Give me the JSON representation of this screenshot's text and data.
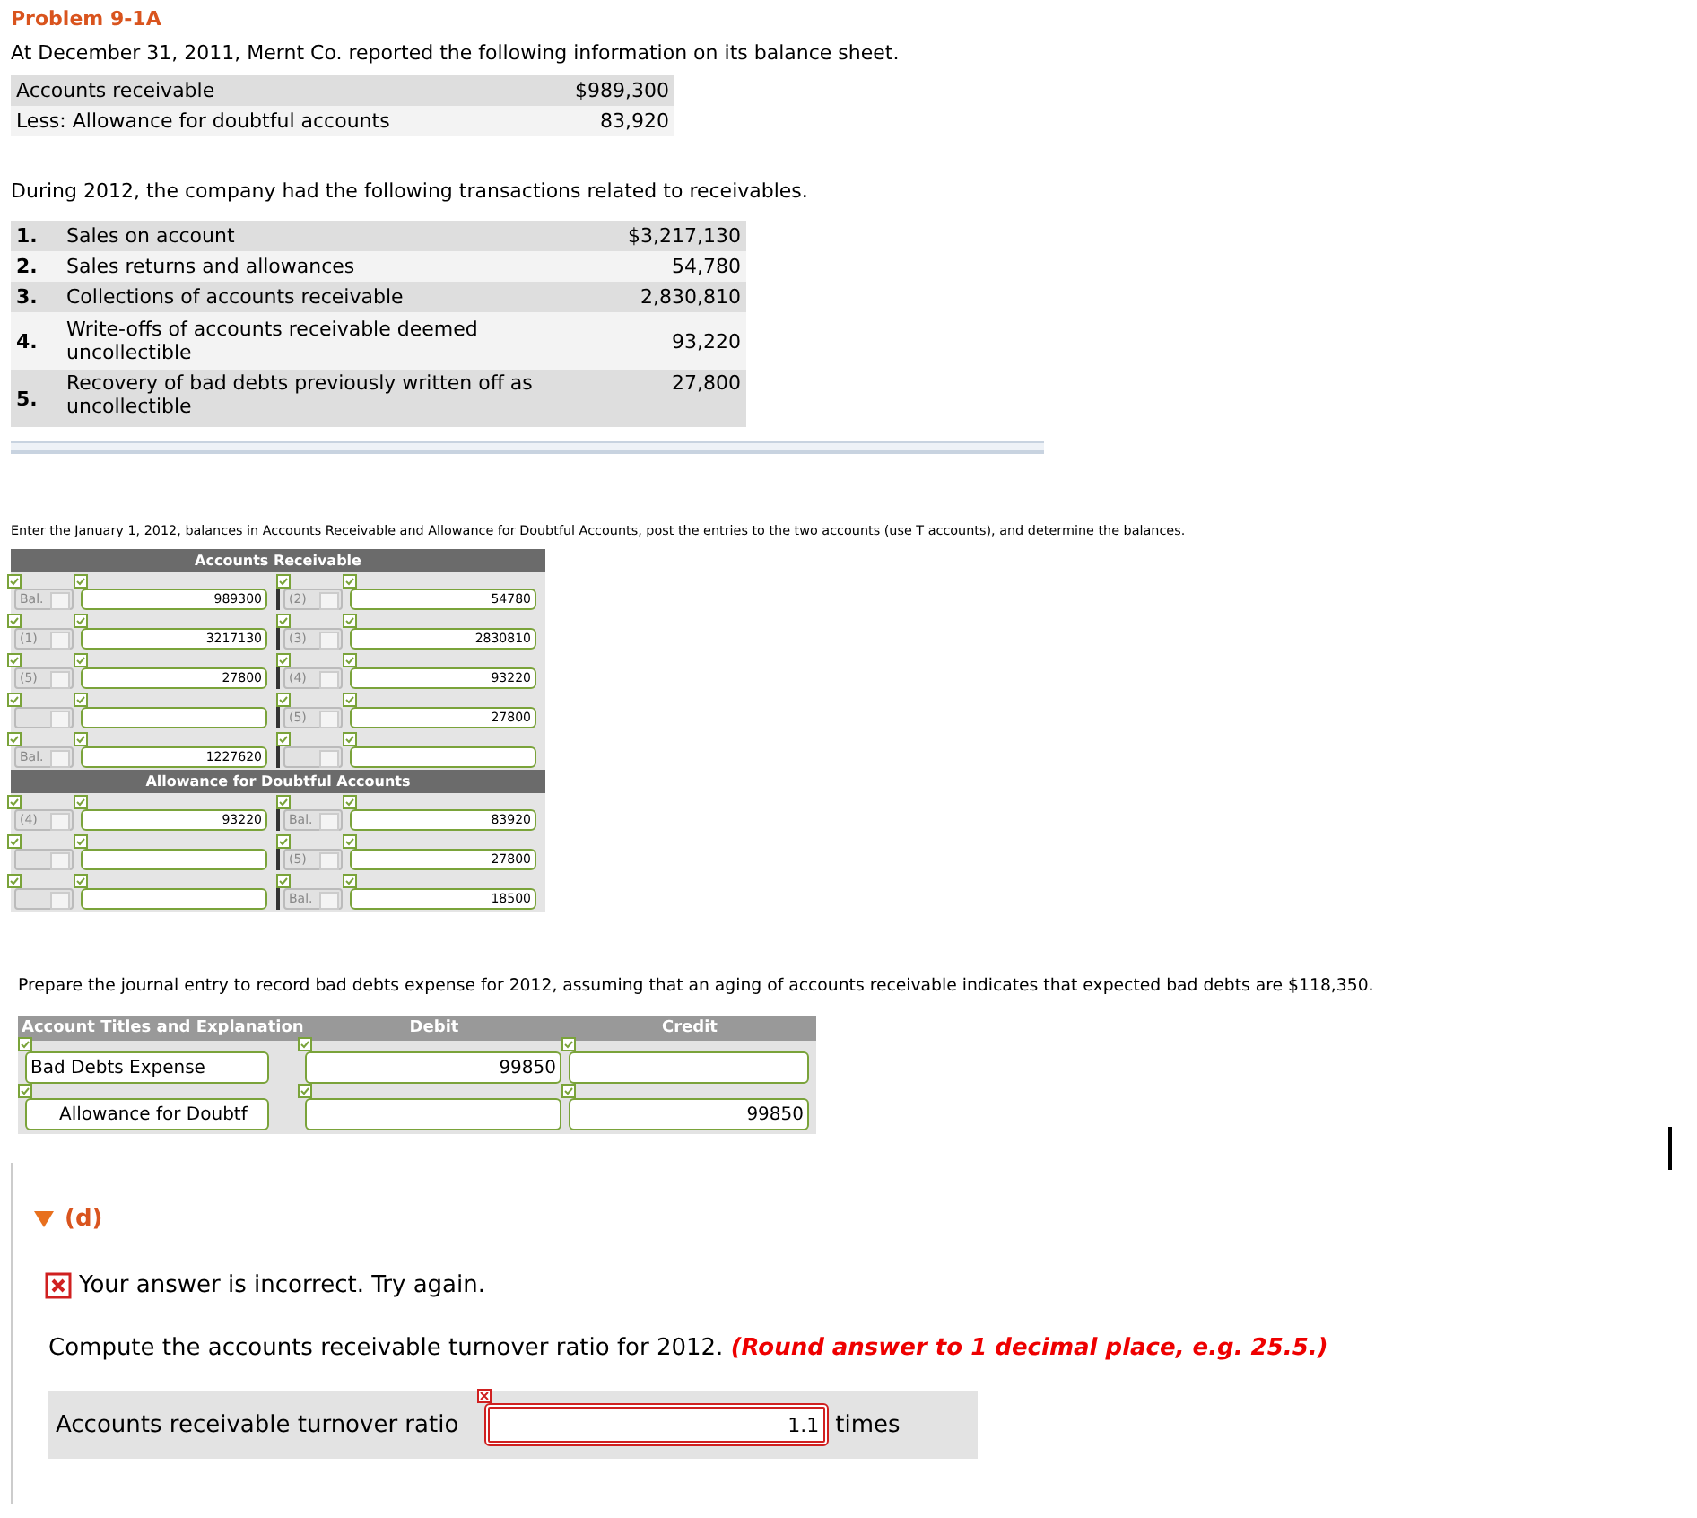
{
  "title": "Problem 9-1A",
  "intro": "At December 31, 2011, Mernt Co. reported the following information on its balance sheet.",
  "balance_sheet": [
    {
      "label": "Accounts receivable",
      "amount": "$989,300"
    },
    {
      "label": "Less: Allowance for doubtful accounts",
      "amount": "83,920"
    }
  ],
  "transactions_intro": "During 2012, the company had the following transactions related to receivables.",
  "transactions": [
    {
      "number": "1.",
      "description": "Sales on account",
      "amount": "$3,217,130"
    },
    {
      "number": "2.",
      "description": "Sales returns and allowances",
      "amount": "54,780"
    },
    {
      "number": "3.",
      "description": "Collections of accounts receivable",
      "amount": "2,830,810"
    },
    {
      "number": "4.",
      "description": "Write-offs of accounts receivable deemed uncollectible",
      "amount": "93,220"
    },
    {
      "number": "5.",
      "description": "Recovery of bad debts previously written off as uncollectible",
      "amount": "27,800"
    }
  ],
  "t_accounts_instruction": "Enter the January 1, 2012, balances in Accounts Receivable and Allowance for Doubtful Accounts, post the entries to the two accounts (use T accounts), and determine the balances.",
  "t_accounts": [
    {
      "title": "Accounts Receivable",
      "rows": [
        {
          "left": {
            "label": "Bal.",
            "value": "989300",
            "correct": true
          },
          "right": {
            "label": "(2)",
            "value": "54780",
            "correct": true
          }
        },
        {
          "left": {
            "label": "(1)",
            "value": "3217130",
            "correct": true
          },
          "right": {
            "label": "(3)",
            "value": "2830810",
            "correct": true
          }
        },
        {
          "left": {
            "label": "(5)",
            "value": "27800",
            "correct": true
          },
          "right": {
            "label": "(4)",
            "value": "93220",
            "correct": true
          }
        },
        {
          "left": {
            "correct": true
          },
          "right": {
            "label": "(5)",
            "value": "27800",
            "correct": true
          }
        },
        {
          "left": {
            "label": "Bal.",
            "value": "1227620",
            "correct": true
          },
          "right": {
            "correct": true
          }
        }
      ]
    },
    {
      "title": "Allowance for Doubtful Accounts",
      "rows": [
        {
          "left": {
            "label": "(4)",
            "value": "93220",
            "correct": true
          },
          "right": {
            "label": "Bal.",
            "value": "83920",
            "correct": true
          }
        },
        {
          "left": {
            "correct": true
          },
          "right": {
            "label": "(5)",
            "value": "27800",
            "correct": true
          }
        },
        {
          "left": {
            "correct": true
          },
          "right": {
            "label": "Bal.",
            "value": "18500",
            "correct": true
          }
        }
      ]
    }
  ],
  "journal_instruction": "Prepare the journal entry to record bad debts expense for 2012, assuming that an aging of accounts receivable indicates that expected bad debts are $118,350.",
  "journal": {
    "columns": [
      "Account Titles and Explanation",
      "Debit",
      "Credit"
    ],
    "rows": [
      {
        "account": "Bad Debts Expense",
        "indented": false,
        "debit": "99850",
        "correct": true
      },
      {
        "account": "Allowance for Doubtf",
        "indented": true,
        "credit": "99850",
        "correct": true
      }
    ]
  },
  "part_d": {
    "label": "(d)",
    "expanded": true,
    "feedback": "Your answer is incorrect.  Try again.",
    "question": "Compute the accounts receivable turnover ratio for 2012. **(Round answer to 1 decimal place, e.g. 25.5.)**",
    "answer": {
      "label": "Accounts receivable turnover ratio",
      "value": "1.1",
      "correct": false,
      "unit": "times"
    }
  }
}
